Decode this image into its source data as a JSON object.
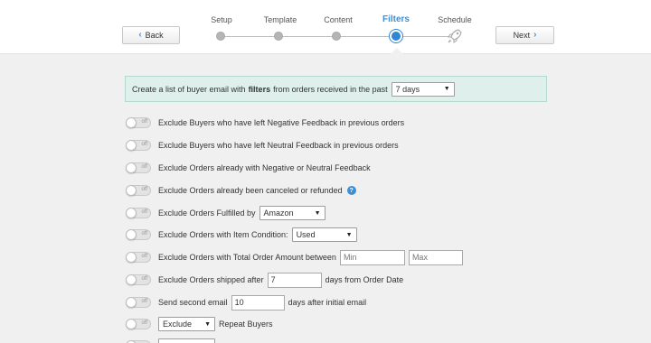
{
  "header": {
    "back_label": "Back",
    "next_label": "Next",
    "steps": [
      {
        "label": "Setup",
        "active": false
      },
      {
        "label": "Template",
        "active": false
      },
      {
        "label": "Content",
        "active": false
      },
      {
        "label": "Filters",
        "active": true
      },
      {
        "label": "Schedule",
        "active": false
      }
    ]
  },
  "intro": {
    "text_before": "Create a list of buyer email with",
    "bold": "filters",
    "text_after": "from orders received in the past",
    "period_value": "7 days"
  },
  "toggle_text": "off",
  "filters": {
    "negative_feedback": "Exclude Buyers who have left Negative Feedback in previous orders",
    "neutral_feedback": "Exclude Buyers who have left Neutral Feedback in previous orders",
    "neg_neutral_orders": "Exclude Orders already with Negative or Neutral Feedback",
    "canceled": "Exclude Orders already been canceled or refunded",
    "fulfilled_label": "Exclude Orders Fulfilled by",
    "fulfilled_value": "Amazon",
    "condition_label": "Exclude Orders with Item Condition:",
    "condition_value": "Used",
    "amount_label": "Exclude Orders with Total Order Amount between",
    "amount_min_placeholder": "Min",
    "amount_max_placeholder": "Max",
    "shipped_label": "Exclude Orders shipped after",
    "shipped_value": "7",
    "shipped_suffix": "days from Order Date",
    "second_email_label": "Send second email",
    "second_email_value": "10",
    "second_email_suffix": "days after initial email",
    "repeat_select": "Exclude",
    "repeat_label": "Repeat Buyers"
  },
  "colors": {
    "accent": "#2f86d6",
    "info_bg": "#dff0ec",
    "page_bg": "#f0f0f0"
  }
}
